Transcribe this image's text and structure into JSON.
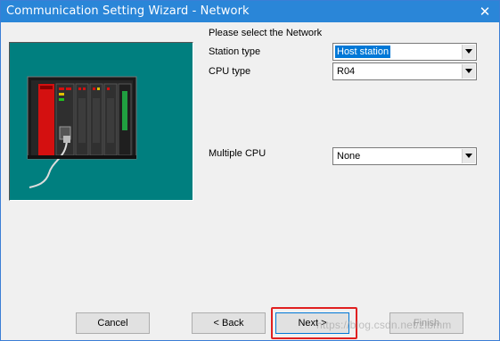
{
  "window": {
    "title": "Communication Setting Wizard - Network",
    "close_glyph": "✕"
  },
  "form": {
    "heading": "Please select the Network",
    "station_type": {
      "label": "Station type",
      "value": "Host station"
    },
    "cpu_type": {
      "label": "CPU type",
      "value": "R04"
    },
    "multiple_cpu": {
      "label": "Multiple CPU",
      "value": "None"
    }
  },
  "buttons": {
    "cancel": "Cancel",
    "back": "< Back",
    "next": "Next >",
    "finish": "Finish"
  },
  "watermark": "https://blog.csdn.net/zlbmm",
  "colors": {
    "titlebar": "#2a86d8",
    "illustration_bg": "#007f7f",
    "highlight": "#e02020",
    "selection": "#0078d7"
  },
  "icons": {
    "illustration": "plc-rack-illustration",
    "close": "close-icon",
    "dropdown": "chevron-down-icon"
  }
}
